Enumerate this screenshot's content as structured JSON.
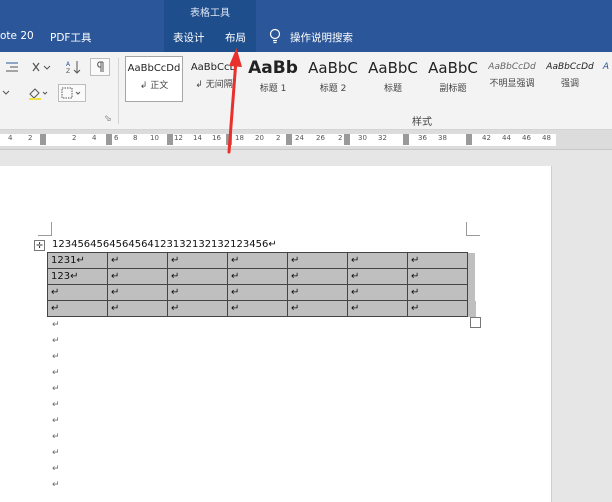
{
  "tabs": {
    "left_partial": "ote 20",
    "pdf": "PDF工具",
    "context_group": "表格工具",
    "table_design": "表设计",
    "layout": "布局",
    "tell_me": "操作说明搜索"
  },
  "ribbon": {
    "styles_group_label": "样式",
    "styles": [
      {
        "sample": "AaBbCcDd",
        "name": "↲ 正文"
      },
      {
        "sample": "AaBbCcD",
        "name": "↲ 无间隔"
      },
      {
        "sample": "AaBb",
        "name": "标题 1"
      },
      {
        "sample": "AaBbC",
        "name": "标题 2"
      },
      {
        "sample": "AaBbC",
        "name": "标题"
      },
      {
        "sample": "AaBbC",
        "name": "副标题"
      },
      {
        "sample": "AaBbCcDd",
        "name": "不明显强调"
      },
      {
        "sample": "AaBbCcDd",
        "name": "强调"
      },
      {
        "sample": "A",
        "name": ""
      }
    ],
    "launcher": "⬂"
  },
  "ruler": {
    "numbers": [
      "4",
      "2",
      "2",
      "4",
      "6",
      "8",
      "10",
      "12",
      "14",
      "16",
      "18",
      "20",
      "2",
      "24",
      "26",
      "2",
      "30",
      "32",
      "36",
      "38",
      "42",
      "44",
      "46",
      "48"
    ]
  },
  "document": {
    "line1": "1234564564564564123132132132123456↵",
    "table": [
      [
        "1231↵",
        "↵",
        "↵",
        "↵",
        "↵",
        "↵",
        "↵"
      ],
      [
        "123↵",
        "↵",
        "↵",
        "↵",
        "↵",
        "↵",
        "↵"
      ],
      [
        "↵",
        "↵",
        "↵",
        "↵",
        "↵",
        "↵",
        "↵"
      ],
      [
        "↵",
        "↵",
        "↵",
        "↵",
        "↵",
        "↵",
        "↵"
      ]
    ],
    "paragraph_marks": [
      "↵",
      "↵",
      "↵",
      "↵",
      "↵",
      "↵",
      "↵",
      "↵",
      "↵",
      "↵",
      "↵"
    ],
    "move_handle": "✛"
  },
  "colors": {
    "title_bar": "#2b579a",
    "context_tab": "#1f4e8c",
    "annotation_arrow": "#e8302c",
    "table_shading": "#bfbfbf"
  }
}
